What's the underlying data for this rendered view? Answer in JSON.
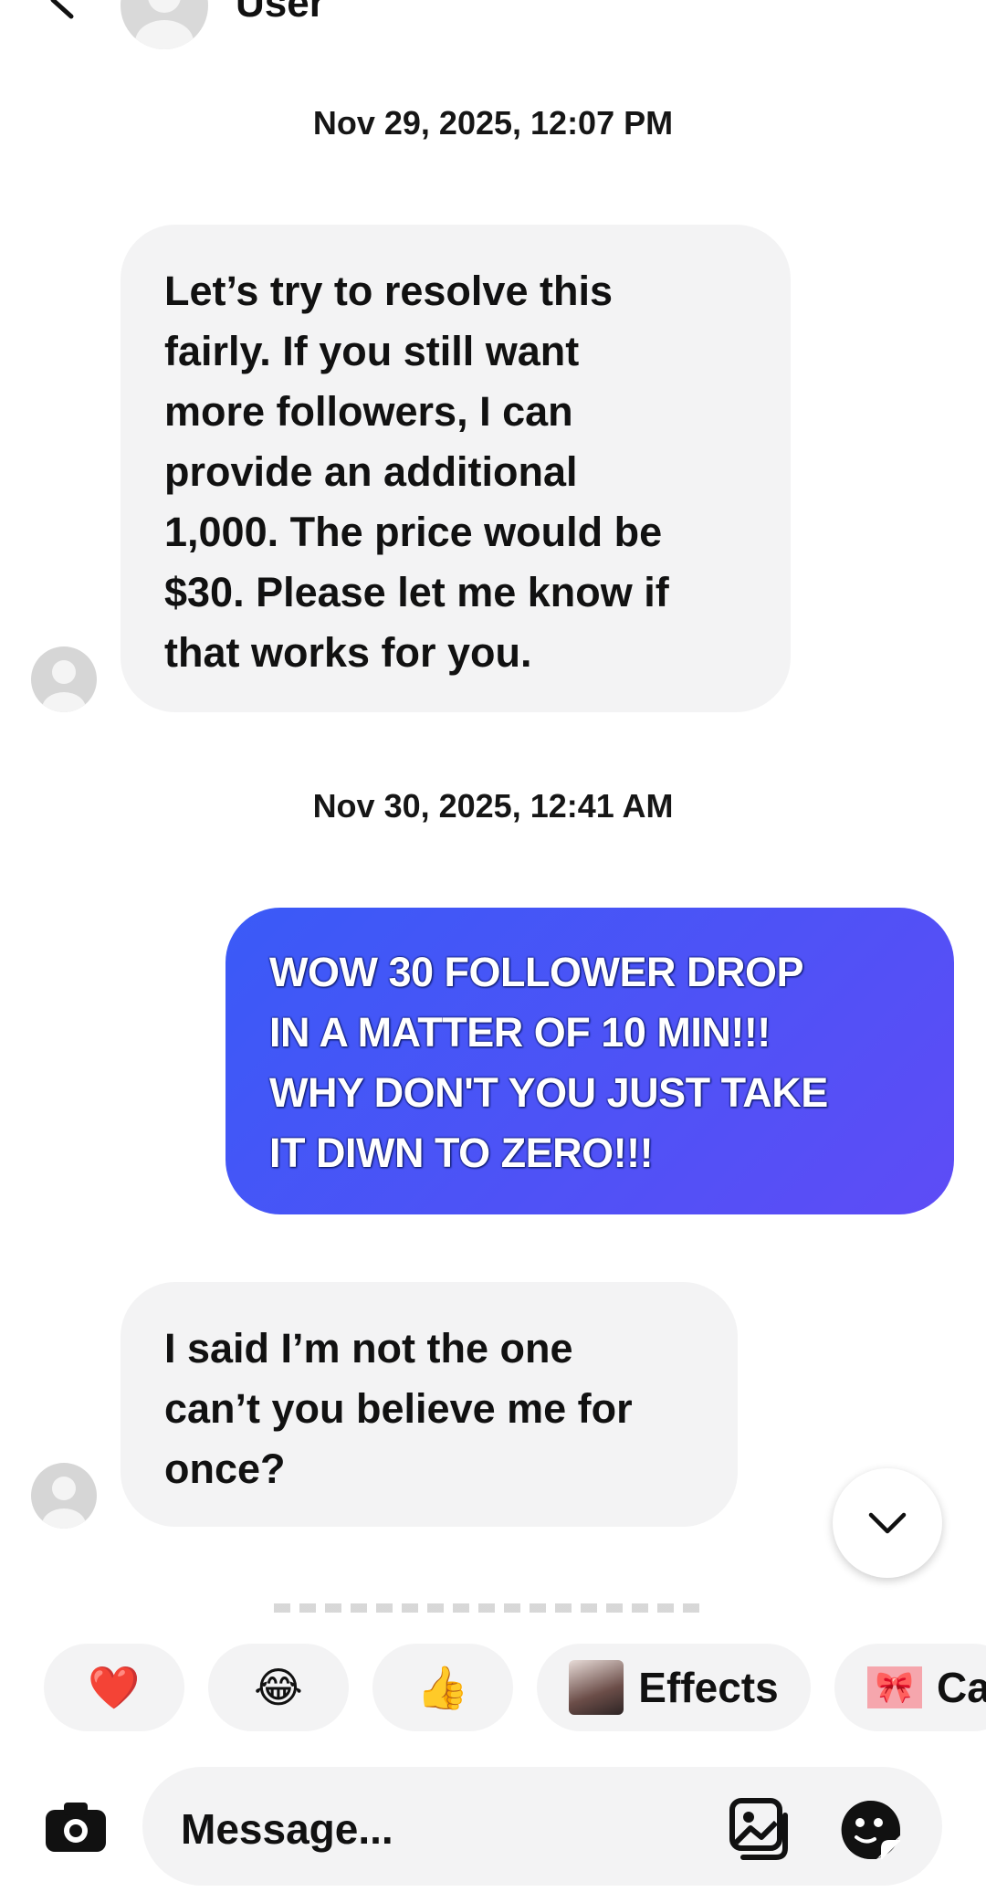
{
  "header": {
    "name": "User"
  },
  "messages": [
    {
      "type": "timestamp",
      "text": "Nov 29, 2025, 12:07 PM"
    },
    {
      "type": "incoming",
      "lines": [
        "Let’s try to resolve this",
        "fairly. If you still want",
        "more followers, I can",
        "provide an additional",
        "1,000. The price would be",
        "$30. Please let me know if",
        "that works for you."
      ]
    },
    {
      "type": "timestamp",
      "text": "Nov 30, 2025, 12:41 AM"
    },
    {
      "type": "outgoing",
      "lines": [
        "WOW 30 FOLLOWER DROP",
        "IN A MATTER OF 10 MIN!!!",
        "WHY DON'T YOU JUST TAKE",
        "IT DIWN TO ZERO!!!"
      ]
    },
    {
      "type": "incoming",
      "lines": [
        "I said I’m not the one",
        "can’t you believe me for",
        "once?"
      ]
    }
  ],
  "quick_reactions": [
    {
      "emoji": "❤️",
      "icon": "heart-icon"
    },
    {
      "emoji": "😂",
      "icon": "laughing-face-icon"
    },
    {
      "emoji": "👍",
      "icon": "thumbs-up-icon"
    }
  ],
  "effects": {
    "label": "Effects"
  },
  "next_chip": {
    "label": "Ca"
  },
  "composer": {
    "placeholder": "Message..."
  },
  "colors": {
    "outgoing_bubble_start": "#3a5af7",
    "outgoing_bubble_end": "#5e4cf6",
    "incoming_bubble": "#f3f3f4"
  }
}
